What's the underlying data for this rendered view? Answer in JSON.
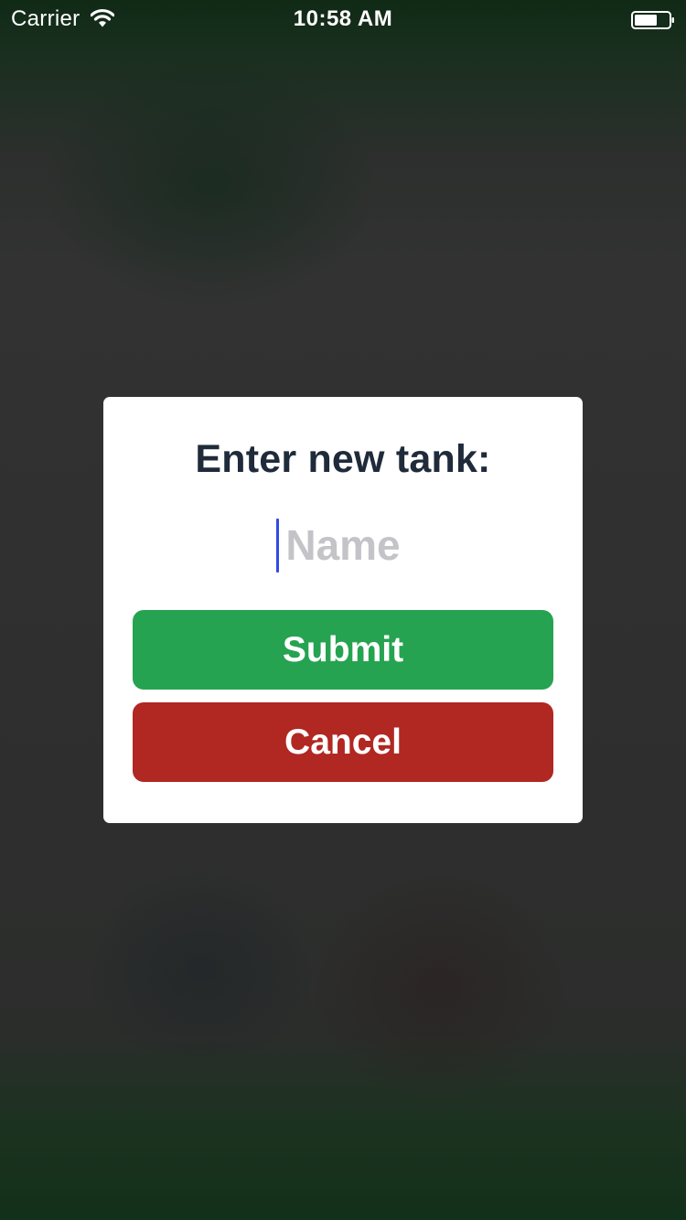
{
  "status_bar": {
    "carrier": "Carrier",
    "time": "10:58 AM",
    "wifi_icon": "wifi-icon",
    "battery_icon": "battery-icon"
  },
  "dialog": {
    "title": "Enter new tank:",
    "name_input": {
      "value": "",
      "placeholder": "Name"
    },
    "submit_label": "Submit",
    "cancel_label": "Cancel"
  },
  "colors": {
    "submit": "#26a350",
    "cancel": "#b12722",
    "title_text": "#1f2a3a",
    "placeholder": "#c3c3c8",
    "caret": "#3148e8"
  }
}
